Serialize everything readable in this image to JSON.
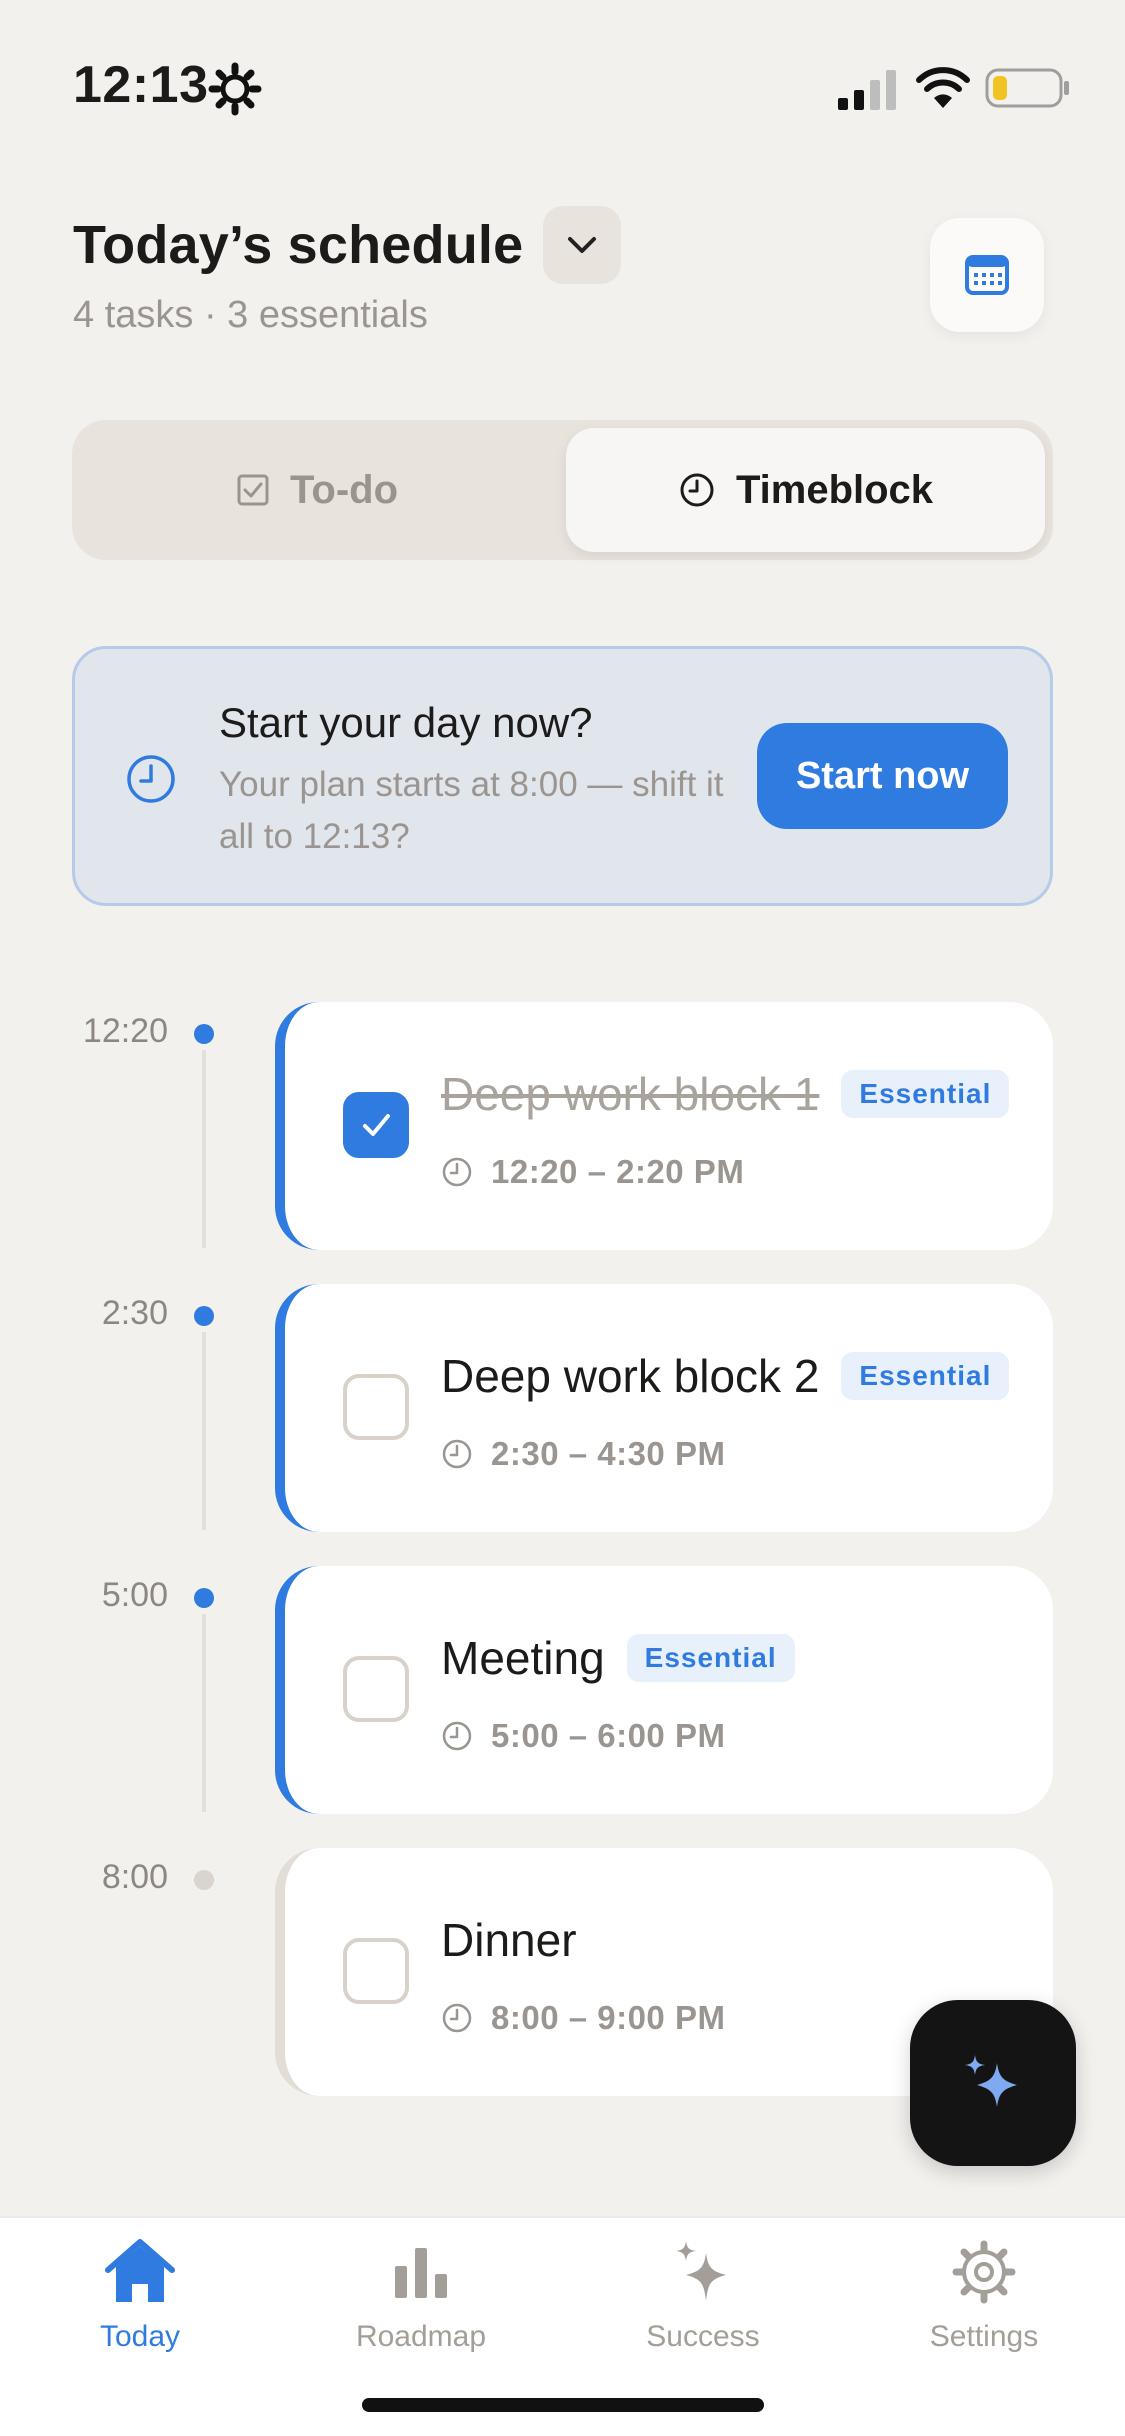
{
  "status_bar": {
    "time": "12:13",
    "icons": [
      "gear-icon",
      "cellular-signal-icon",
      "wifi-icon",
      "battery-low-icon"
    ]
  },
  "header": {
    "title": "Today’s schedule",
    "subtitle": "4 tasks · 3 essentials",
    "dropdown_icon": "chevron-down-icon",
    "calendar_icon": "calendar-icon"
  },
  "view_toggle": {
    "options": [
      {
        "label": "To-do",
        "icon": "checkbox-icon",
        "selected": false
      },
      {
        "label": "Timeblock",
        "icon": "clock-icon",
        "selected": true
      }
    ]
  },
  "banner": {
    "title": "Start your day now?",
    "text": "Your plan starts at 8:00 — shift it all to 12:13?",
    "button_label": "Start now",
    "icon": "clock-icon"
  },
  "schedule": [
    {
      "time_label": "12:20",
      "title": "Deep work block 1",
      "badge": "Essential",
      "time_range": "12:20 – 2:20 PM",
      "done": true
    },
    {
      "time_label": "2:30",
      "title": "Deep work block 2",
      "badge": "Essential",
      "time_range": "2:30 – 4:30 PM",
      "done": false
    },
    {
      "time_label": "5:00",
      "title": "Meeting",
      "badge": "Essential",
      "time_range": "5:00 – 6:00 PM",
      "done": false
    },
    {
      "time_label": "8:00",
      "title": "Dinner",
      "badge": "",
      "time_range": "8:00 – 9:00 PM",
      "done": false
    }
  ],
  "fab": {
    "icon": "sparkles-icon"
  },
  "tab_bar": {
    "tabs": [
      {
        "label": "Today",
        "icon": "home-icon",
        "active": true
      },
      {
        "label": "Roadmap",
        "icon": "bar-chart-icon",
        "active": false
      },
      {
        "label": "Success",
        "icon": "sparkles-icon",
        "active": false
      },
      {
        "label": "Settings",
        "icon": "gear-icon",
        "active": false
      }
    ]
  },
  "colors": {
    "background": "#F3F1EE",
    "accent": "#2F7BE0",
    "badge_background": "#E8F0FB",
    "muted_text": "#9A9590"
  }
}
